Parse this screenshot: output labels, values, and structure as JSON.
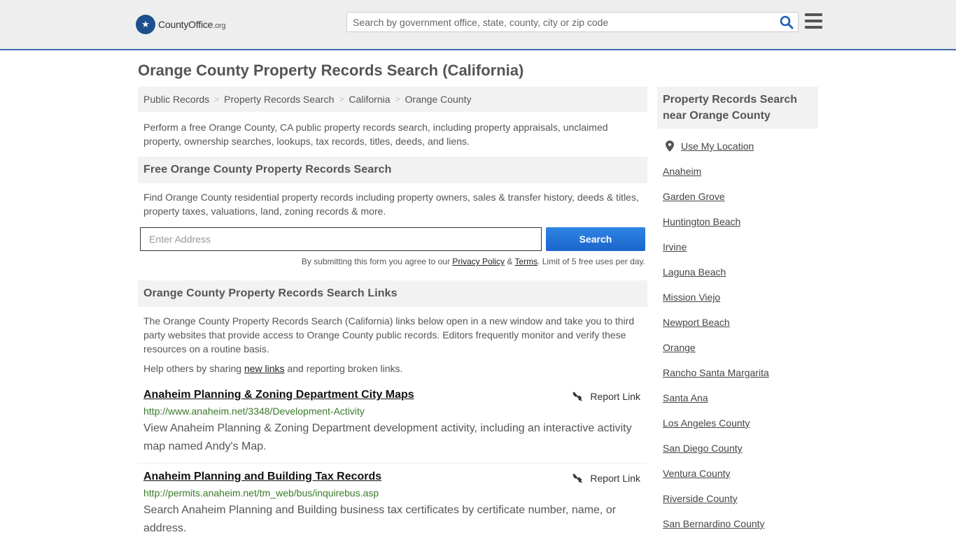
{
  "header": {
    "logo_text": "CountyOffice",
    "logo_tld": ".org",
    "search_placeholder": "Search by government office, state, county, city or zip code"
  },
  "page_title": "Orange County Property Records Search (California)",
  "breadcrumb": [
    "Public Records",
    "Property Records Search",
    "California",
    "Orange County"
  ],
  "intro": "Perform a free Orange County, CA public property records search, including property appraisals, unclaimed property, ownership searches, lookups, tax records, titles, deeds, and liens.",
  "free_search": {
    "heading": "Free Orange County Property Records Search",
    "description": "Find Orange County residential property records including property owners, sales & transfer history, deeds & titles, property taxes, valuations, land, zoning records & more.",
    "address_placeholder": "Enter Address",
    "search_label": "Search",
    "disclaimer_prefix": "By submitting this form you agree to our ",
    "privacy_label": "Privacy Policy",
    "amp": " & ",
    "terms_label": "Terms",
    "disclaimer_suffix": ". Limit of 5 free uses per day."
  },
  "links_section": {
    "heading": "Orange County Property Records Search Links",
    "description": "The Orange County Property Records Search (California) links below open in a new window and take you to third party websites that provide access to Orange County public records. Editors frequently monitor and verify these resources on a routine basis.",
    "help_prefix": "Help others by sharing ",
    "help_link": "new links",
    "help_suffix": " and reporting broken links.",
    "report_label": "Report Link",
    "items": [
      {
        "title": "Anaheim Planning & Zoning Department City Maps",
        "url": "http://www.anaheim.net/3348/Development-Activity",
        "body": "View Anaheim Planning & Zoning Department development activity, including an interactive activity map named Andy's Map."
      },
      {
        "title": "Anaheim Planning and Building Tax Records",
        "url": "http://permits.anaheim.net/tm_web/bus/inquirebus.asp",
        "body": "Search Anaheim Planning and Building business tax certificates by certificate number, name, or address."
      }
    ]
  },
  "sidebar": {
    "heading": "Property Records Search near Orange County",
    "use_location": "Use My Location",
    "items": [
      "Anaheim",
      "Garden Grove",
      "Huntington Beach",
      "Irvine",
      "Laguna Beach",
      "Mission Viejo",
      "Newport Beach",
      "Orange",
      "Rancho Santa Margarita",
      "Santa Ana",
      "Los Angeles County",
      "San Diego County",
      "Ventura County",
      "Riverside County",
      "San Bernardino County"
    ]
  },
  "colors": {
    "header_bg": "#eeeeee",
    "header_border": "#3f6ea8",
    "search_icon": "#1d5fb4",
    "button": "#1a66cc",
    "url_green": "#3a7a2a"
  }
}
